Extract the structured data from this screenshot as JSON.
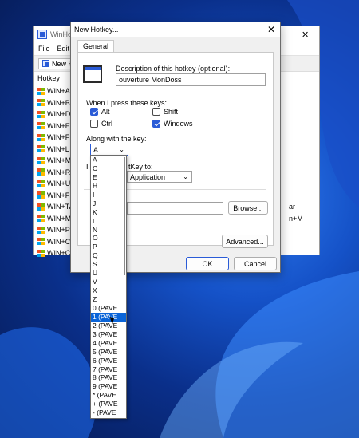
{
  "back_window": {
    "title": "WinHo",
    "close": "✕",
    "menu": [
      "File",
      "Edit"
    ],
    "toolbar_new": "New H",
    "column_header": "Hotkey",
    "rows": [
      {
        "label": "WIN+A",
        "right": ""
      },
      {
        "label": "WIN+B",
        "right": ""
      },
      {
        "label": "WIN+D",
        "right": ""
      },
      {
        "label": "WIN+E",
        "right": ""
      },
      {
        "label": "WIN+F",
        "right": ""
      },
      {
        "label": "WIN+L",
        "right": ""
      },
      {
        "label": "WIN+M",
        "right": ""
      },
      {
        "label": "WIN+R",
        "right": ""
      },
      {
        "label": "WIN+U",
        "right": ""
      },
      {
        "label": "WIN+F",
        "right": ""
      },
      {
        "label": "WIN+TA",
        "right": "ar"
      },
      {
        "label": "WIN+M",
        "right": "n+M"
      },
      {
        "label": "WIN+Pa",
        "right": ""
      },
      {
        "label": "WIN+CT",
        "right": ""
      },
      {
        "label": "WIN+CT",
        "right": ""
      }
    ]
  },
  "dialog": {
    "title": "New Hotkey...",
    "close": "✕",
    "tab": "General",
    "description_label": "Description of this hotkey (optional):",
    "description_value": "ouverture MonDoss",
    "press_label": "When I press these keys:",
    "modifiers": {
      "alt": {
        "label": "Alt",
        "checked": true
      },
      "shift": {
        "label": "Shift",
        "checked": false
      },
      "ctrl": {
        "label": "Ctrl",
        "checked": false
      },
      "windows": {
        "label": "Windows",
        "checked": true
      }
    },
    "along_label": "Along with the key:",
    "key_value": "A",
    "partial_left": "I",
    "partial_right": "tKey to:",
    "action_value": "Application",
    "browse": "Browse...",
    "advanced": "Advanced...",
    "ok": "OK",
    "cancel": "Cancel"
  },
  "dropdown": {
    "items": [
      "A",
      "C",
      "E",
      "H",
      "I",
      "J",
      "K",
      "L",
      "N",
      "O",
      "P",
      "Q",
      "S",
      "U",
      "V",
      "X",
      "Z",
      "0 (PAVE",
      "1 (PAVE",
      "2 (PAVE",
      "3 (PAVE",
      "4 (PAVE",
      "5 (PAVE",
      "6 (PAVE",
      "7 (PAVE",
      "8 (PAVE",
      "9 (PAVE",
      "* (PAVE",
      "+ (PAVE",
      "- (PAVE"
    ],
    "selected": "1 (PAVE"
  }
}
